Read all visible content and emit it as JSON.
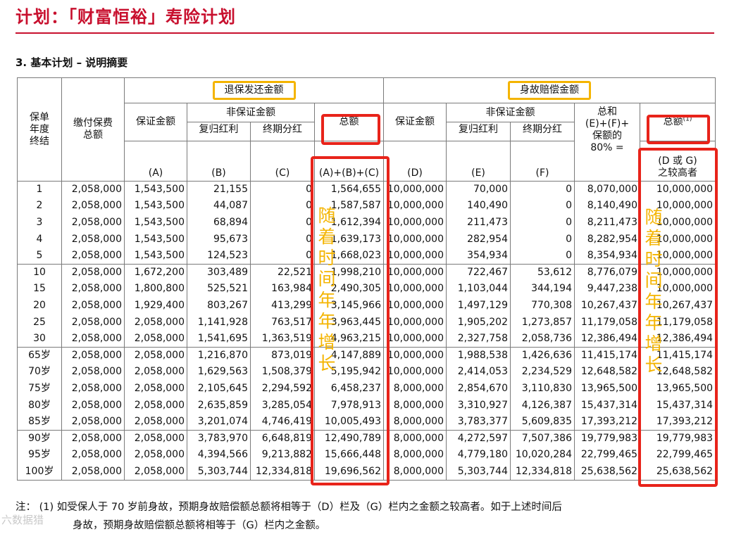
{
  "header": {
    "title": "计划：「财富恒裕」寿险计划"
  },
  "section_title": "3. 基本计划 – 说明摘要",
  "columns": {
    "policy_year": "保单\n年度\n终结",
    "total_premium": "缴付保费\n总额",
    "surrender_group": "退保发还金额",
    "death_group": "身故赔偿金额",
    "surrender": {
      "guaranteed": "保证金额",
      "non_guaranteed": "非保证金额",
      "reversionary": "复归红利",
      "terminal": "终期分红",
      "total": "总额",
      "letter_a": "(A)",
      "letter_b": "(B)",
      "letter_c": "(C)",
      "total_formula": "(A)+(B)+(C)"
    },
    "death": {
      "guaranteed": "保证金额",
      "non_guaranteed": "非保证金额",
      "reversionary": "复归红利",
      "terminal": "终期分红",
      "sum_label": "总和\n(E)+(F)+\n保额的\n80% =",
      "total": "总额",
      "total_sup": "(1)",
      "letter_d": "(D)",
      "letter_e": "(E)",
      "letter_f": "(F)",
      "letter_g": "(G)",
      "total_formula": "(D 或 G)\n之较高者"
    }
  },
  "rows": [
    [
      "1",
      "2,058,000",
      "1,543,500",
      "21,155",
      "0",
      "1,564,655",
      "10,000,000",
      "70,000",
      "0",
      "8,070,000",
      "10,000,000"
    ],
    [
      "2",
      "2,058,000",
      "1,543,500",
      "44,087",
      "0",
      "1,587,587",
      "10,000,000",
      "140,490",
      "0",
      "8,140,490",
      "10,000,000"
    ],
    [
      "3",
      "2,058,000",
      "1,543,500",
      "68,894",
      "0",
      "1,612,394",
      "10,000,000",
      "211,473",
      "0",
      "8,211,473",
      "10,000,000"
    ],
    [
      "4",
      "2,058,000",
      "1,543,500",
      "95,673",
      "0",
      "1,639,173",
      "10,000,000",
      "282,954",
      "0",
      "8,282,954",
      "10,000,000"
    ],
    [
      "5",
      "2,058,000",
      "1,543,500",
      "124,523",
      "0",
      "1,668,023",
      "10,000,000",
      "354,934",
      "0",
      "8,354,934",
      "10,000,000"
    ],
    [
      "10",
      "2,058,000",
      "1,672,200",
      "303,489",
      "22,521",
      "1,998,210",
      "10,000,000",
      "722,467",
      "53,612",
      "8,776,079",
      "10,000,000"
    ],
    [
      "15",
      "2,058,000",
      "1,800,800",
      "525,521",
      "163,984",
      "2,490,305",
      "10,000,000",
      "1,103,044",
      "344,194",
      "9,447,238",
      "10,000,000"
    ],
    [
      "20",
      "2,058,000",
      "1,929,400",
      "803,267",
      "413,299",
      "3,145,966",
      "10,000,000",
      "1,497,129",
      "770,308",
      "10,267,437",
      "10,267,437"
    ],
    [
      "25",
      "2,058,000",
      "2,058,000",
      "1,141,928",
      "763,517",
      "3,963,445",
      "10,000,000",
      "1,905,202",
      "1,273,857",
      "11,179,058",
      "11,179,058"
    ],
    [
      "30",
      "2,058,000",
      "2,058,000",
      "1,541,695",
      "1,363,519",
      "4,963,215",
      "10,000,000",
      "2,327,758",
      "2,058,736",
      "12,386,494",
      "12,386,494"
    ],
    [
      "65岁",
      "2,058,000",
      "2,058,000",
      "1,216,870",
      "873,019",
      "4,147,889",
      "10,000,000",
      "1,988,538",
      "1,426,636",
      "11,415,174",
      "11,415,174"
    ],
    [
      "70岁",
      "2,058,000",
      "2,058,000",
      "1,629,563",
      "1,508,379",
      "5,195,942",
      "10,000,000",
      "2,414,053",
      "2,234,529",
      "12,648,582",
      "12,648,582"
    ],
    [
      "75岁",
      "2,058,000",
      "2,058,000",
      "2,105,645",
      "2,294,592",
      "6,458,237",
      "8,000,000",
      "2,854,670",
      "3,110,830",
      "13,965,500",
      "13,965,500"
    ],
    [
      "80岁",
      "2,058,000",
      "2,058,000",
      "2,635,859",
      "3,285,054",
      "7,978,913",
      "8,000,000",
      "3,310,927",
      "4,126,387",
      "15,437,314",
      "15,437,314"
    ],
    [
      "85岁",
      "2,058,000",
      "2,058,000",
      "3,201,074",
      "4,746,419",
      "10,005,493",
      "8,000,000",
      "3,783,377",
      "5,609,835",
      "17,393,212",
      "17,393,212"
    ],
    [
      "90岁",
      "2,058,000",
      "2,058,000",
      "3,783,970",
      "6,648,819",
      "12,490,789",
      "8,000,000",
      "4,272,597",
      "7,507,386",
      "19,779,983",
      "19,779,983"
    ],
    [
      "95岁",
      "2,058,000",
      "2,058,000",
      "4,394,566",
      "9,213,882",
      "15,666,448",
      "8,000,000",
      "4,779,180",
      "10,020,284",
      "22,799,465",
      "22,799,465"
    ],
    [
      "100岁",
      "2,058,000",
      "2,058,000",
      "5,303,744",
      "12,334,818",
      "19,696,562",
      "8,000,000",
      "5,303,744",
      "12,334,818",
      "25,638,562",
      "25,638,562"
    ]
  ],
  "group_starts": [
    0,
    5,
    10,
    15
  ],
  "annotation": {
    "vertical_text": [
      "随",
      "着",
      "时",
      "间",
      "年",
      "年",
      "增",
      "长"
    ],
    "highlight_color": "#e8231a",
    "accent_color": "#f4b400"
  },
  "footnote": {
    "line1": "注：  (1) 如受保人于 70 岁前身故，预期身故赔偿额总额将相等于（D）栏及（G）栏内之金额之较高者。如于上述时间后",
    "line2": "身故，预期身故赔偿额总额将相等于（G）栏内之金额。"
  },
  "watermark": "六数据猎"
}
